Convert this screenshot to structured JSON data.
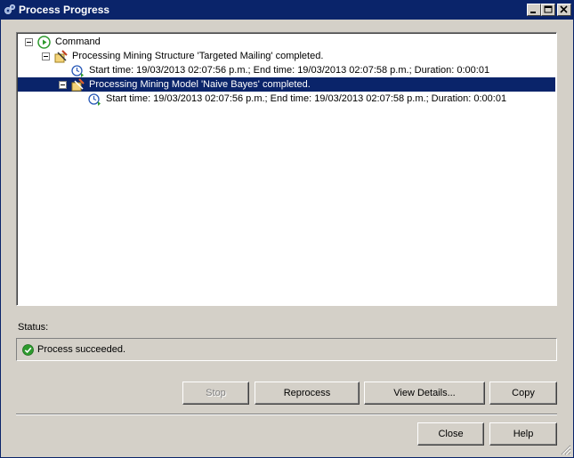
{
  "window": {
    "title": "Process Progress",
    "controls": {
      "minimize": "minimize",
      "maximize": "maximize",
      "close": "close"
    }
  },
  "tree": {
    "nodes": [
      {
        "label": "Command",
        "icon": "play-icon",
        "expanded": true,
        "selected": false
      },
      {
        "label": "Processing Mining Structure 'Targeted Mailing' completed.",
        "icon": "mining-structure-icon",
        "expanded": true,
        "selected": false
      },
      {
        "label": "Start time: 19/03/2013 02:07:56 p.m.; End time: 19/03/2013 02:07:58 p.m.; Duration: 0:00:01",
        "icon": "timer-icon",
        "selected": false
      },
      {
        "label": "Processing Mining Model 'Naive Bayes' completed.",
        "icon": "mining-model-icon",
        "expanded": true,
        "selected": true
      },
      {
        "label": "Start time: 19/03/2013 02:07:56 p.m.; End time: 19/03/2013 02:07:58 p.m.; Duration: 0:00:01",
        "icon": "timer-icon",
        "selected": false
      }
    ]
  },
  "status": {
    "label": "Status:",
    "message": "Process succeeded.",
    "icon": "check-icon",
    "color": "#2e9a2e"
  },
  "buttons": {
    "stop": "Stop",
    "reprocess": "Reprocess",
    "view_details": "View Details...",
    "copy": "Copy",
    "close": "Close",
    "help": "Help"
  },
  "colors": {
    "title_bar": "#0a246a",
    "selection": "#0a246a",
    "face": "#d4d0c8"
  }
}
